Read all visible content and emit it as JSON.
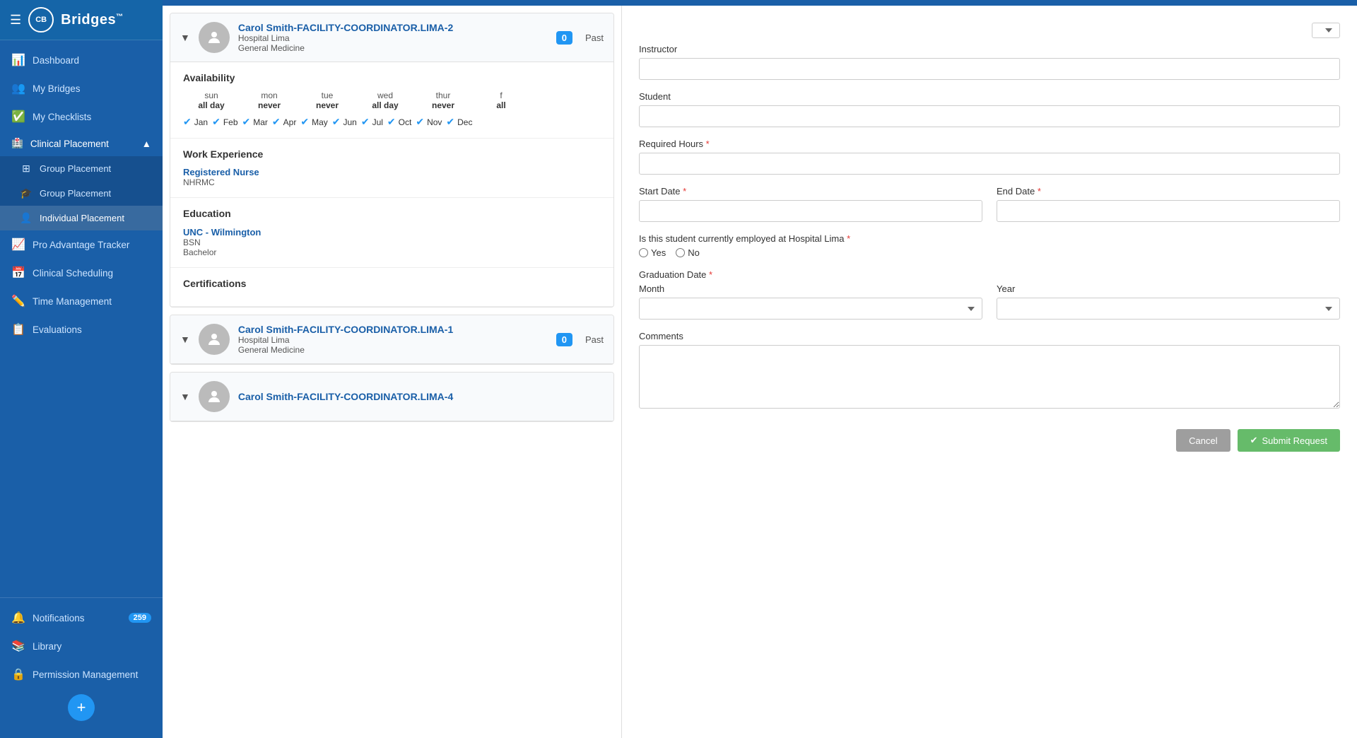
{
  "sidebar": {
    "logo": {
      "initials": "CB",
      "name": "Bridges",
      "tm": "™"
    },
    "nav": [
      {
        "id": "dashboard",
        "label": "Dashboard",
        "icon": "📊"
      },
      {
        "id": "my-bridges",
        "label": "My Bridges",
        "icon": "👥"
      },
      {
        "id": "my-checklists",
        "label": "My Checklists",
        "icon": "✅"
      }
    ],
    "clinical_placement": {
      "label": "Clinical Placement",
      "icon": "🏥",
      "sub_items": [
        {
          "id": "group-placement-1",
          "label": "Group Placement",
          "icon": "⊞"
        },
        {
          "id": "group-placement-2",
          "label": "Group Placement",
          "icon": "🎓"
        },
        {
          "id": "individual-placement",
          "label": "Individual Placement",
          "icon": "👤",
          "active": true
        }
      ]
    },
    "bottom_nav": [
      {
        "id": "pro-advantage",
        "label": "Pro Advantage Tracker",
        "icon": "📈"
      },
      {
        "id": "clinical-scheduling",
        "label": "Clinical Scheduling",
        "icon": "📅"
      },
      {
        "id": "time-management",
        "label": "Time Management",
        "icon": "✏️"
      },
      {
        "id": "evaluations",
        "label": "Evaluations",
        "icon": "📋"
      }
    ],
    "utility_nav": [
      {
        "id": "notifications",
        "label": "Notifications",
        "icon": "🔔",
        "badge": "259"
      },
      {
        "id": "library",
        "label": "Library",
        "icon": "📚"
      },
      {
        "id": "permission-management",
        "label": "Permission Management",
        "icon": "🔒"
      }
    ]
  },
  "student_cards": [
    {
      "id": "card-1",
      "name": "Carol Smith-FACILITY-COORDINATOR.LIMA-2",
      "hospital": "Hospital Lima",
      "department": "General Medicine",
      "count": "0",
      "past_label": "Past",
      "availability": {
        "days": [
          {
            "name": "sun",
            "status": "all day"
          },
          {
            "name": "mon",
            "status": "never"
          },
          {
            "name": "tue",
            "status": "never"
          },
          {
            "name": "wed",
            "status": "all day"
          },
          {
            "name": "thur",
            "status": "never"
          },
          {
            "name": "f",
            "status": "all"
          }
        ],
        "months": [
          "Jan",
          "Feb",
          "Mar",
          "Apr",
          "May",
          "Jun",
          "Jul",
          "Oct",
          "Nov",
          "Dec"
        ]
      },
      "work_experience": {
        "title": "Registered Nurse",
        "organization": "NHRMC"
      },
      "education": {
        "school": "UNC - Wilmington",
        "degree": "BSN",
        "type": "Bachelor"
      },
      "certifications_label": "Certifications"
    },
    {
      "id": "card-2",
      "name": "Carol Smith-FACILITY-COORDINATOR.LIMA-1",
      "hospital": "Hospital Lima",
      "department": "General Medicine",
      "count": "0",
      "past_label": "Past"
    },
    {
      "id": "card-3",
      "name": "Carol Smith-FACILITY-COORDINATOR.LIMA-4",
      "hospital": "",
      "department": "",
      "count": "",
      "past_label": ""
    }
  ],
  "form": {
    "top_dropdown_placeholder": "▼",
    "instructor_label": "Instructor",
    "instructor_placeholder": "",
    "student_label": "Student",
    "student_placeholder": "",
    "required_hours_label": "Required Hours",
    "required_hours_asterisk": "*",
    "required_hours_placeholder": "",
    "start_date_label": "Start Date",
    "start_date_asterisk": "*",
    "end_date_label": "End Date",
    "end_date_asterisk": "*",
    "employed_label": "Is this student currently employed at Hospital Lima",
    "employed_asterisk": "*",
    "yes_label": "Yes",
    "no_label": "No",
    "graduation_label": "Graduation Date",
    "graduation_asterisk": "*",
    "month_label": "Month",
    "year_label": "Year",
    "comments_label": "Comments",
    "cancel_label": "Cancel",
    "submit_label": "Submit Request",
    "submit_icon": "✔"
  }
}
